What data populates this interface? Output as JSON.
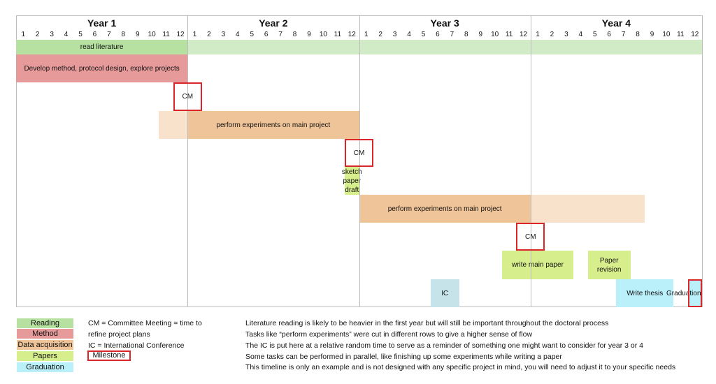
{
  "chart_data": {
    "type": "gantt-timeline",
    "title": "",
    "years": [
      "Year 1",
      "Year 2",
      "Year 3",
      "Year 4"
    ],
    "months": [
      "1",
      "2",
      "3",
      "4",
      "5",
      "6",
      "7",
      "8",
      "9",
      "10",
      "11",
      "12"
    ],
    "colors": {
      "reading": "#b7e1a1",
      "reading_light": "#d2ebc7",
      "method": "#e79a9a",
      "data": "#efc499",
      "data_light": "#f8e2cc",
      "papers": "#d7ee8d",
      "ic": "#c5e3e8",
      "graduation": "#baf0fa",
      "milestone_border": "#d9262b"
    },
    "tasks": [
      {
        "label": "read literature",
        "category": "reading",
        "start": 0,
        "end": 12,
        "row": 0
      },
      {
        "label": "",
        "category": "reading_light",
        "start": 12,
        "end": 48,
        "row": 0
      },
      {
        "label": "Develop method, protocol design, explore projects",
        "category": "method",
        "start": 0,
        "end": 12,
        "row": 1
      },
      {
        "label": "",
        "category": "data_light",
        "start": 10,
        "end": 12,
        "row": 3
      },
      {
        "label": "perform experiments on main project",
        "category": "data",
        "start": 12,
        "end": 24,
        "row": 3
      },
      {
        "label": "sketch paper draft",
        "category": "papers",
        "start": 23,
        "end": 24,
        "row": 5
      },
      {
        "label": "perform experiments on main project",
        "category": "data",
        "start": 24,
        "end": 36,
        "row": 6
      },
      {
        "label": "",
        "category": "data_light",
        "start": 36,
        "end": 44,
        "row": 6
      },
      {
        "label": "write main paper",
        "category": "papers",
        "start": 34,
        "end": 39,
        "row": 8
      },
      {
        "label": "Paper revision",
        "category": "papers",
        "start": 40,
        "end": 43,
        "row": 8
      },
      {
        "label": "IC",
        "category": "ic",
        "start": 29,
        "end": 31,
        "row": 9
      },
      {
        "label": "Write thesis",
        "category": "graduation",
        "start": 42,
        "end": 46,
        "row": 9
      },
      {
        "label": "Graduation",
        "category": "graduation",
        "start": 47,
        "end": 48,
        "row": 9
      }
    ],
    "milestones": [
      {
        "label": "CM",
        "start": 11,
        "end": 13,
        "row": 2
      },
      {
        "label": "CM",
        "start": 23,
        "end": 25,
        "row": 4
      },
      {
        "label": "CM",
        "start": 35,
        "end": 37,
        "row": 7
      },
      {
        "label": "",
        "start": 47,
        "end": 48,
        "row": 9
      }
    ]
  },
  "legend": [
    {
      "label": "Reading",
      "color": "#b7e1a1"
    },
    {
      "label": "Method",
      "color": "#e79a9a"
    },
    {
      "label": "Data acquisition",
      "color": "#efc499"
    },
    {
      "label": "Papers",
      "color": "#d7ee8d"
    },
    {
      "label": "Graduation",
      "color": "#baf0fa"
    }
  ],
  "abbreviations": [
    "CM = Committee Meeting = time to",
    "refine project plans",
    "IC = International Conference"
  ],
  "milestone_legend": "Milestone",
  "notes": [
    "Literature reading is likely to be heavier in the first year but will still be important throughout the doctoral process",
    "Tasks like “perform experiments” were cut in different rows to give a higher sense of flow",
    "The IC is put here at a relative random time to serve as a reminder of something one might want to consider for year 3 or 4",
    "Some tasks can be performed in parallel, like finishing up some experiments while writing a paper",
    "This timeline is only an example and is not designed with any specific project in mind, you will need to adjust it to your specific needs"
  ]
}
